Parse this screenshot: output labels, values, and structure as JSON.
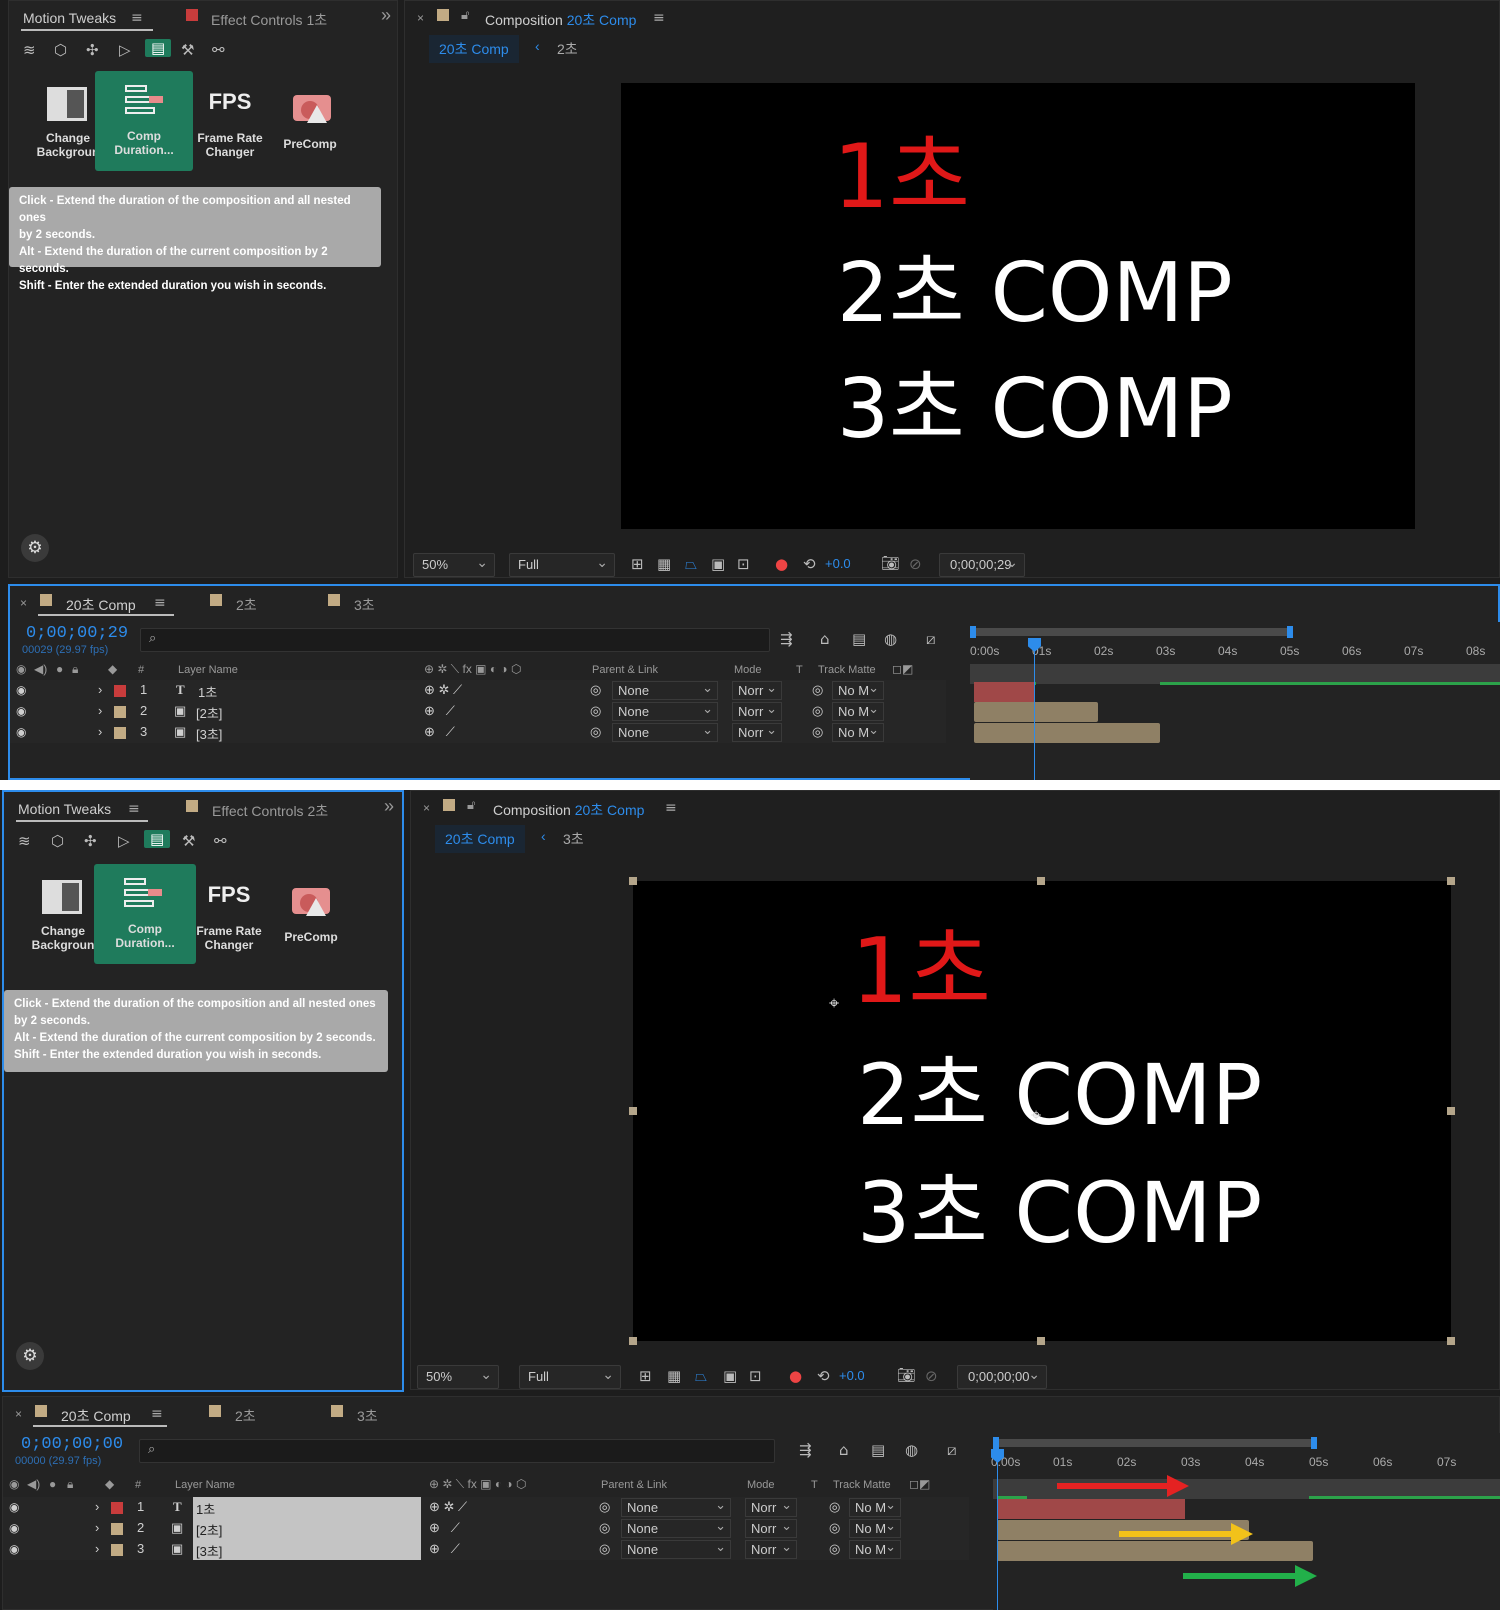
{
  "top": {
    "left_panel": {
      "tab_active": "Motion Tweaks",
      "tab_inactive": "Effect Controls 1초",
      "overflow": "»"
    },
    "comp_panel": {
      "tab_prefix": "Composition",
      "tab_comp": "20초 Comp",
      "breadcrumb_active": "20초 Comp",
      "breadcrumb_next": "2초"
    },
    "viewer_lines": [
      "1초",
      "2초 COMP",
      "3초 COMP"
    ],
    "zoom": "50%",
    "quality": "Full",
    "exposure": "+0.0",
    "timecode": "0;00;00;29",
    "timeline": {
      "tabs": [
        "20초 Comp",
        "2초",
        "3초"
      ],
      "time": "0;00;00;29",
      "frames": "00029 (29.97 fps)",
      "ruler": [
        "0:00s",
        "01s",
        "02s",
        "03s",
        "04s",
        "05s",
        "06s",
        "07s",
        "08s"
      ]
    }
  },
  "bottom": {
    "left_panel": {
      "tab_active": "Motion Tweaks",
      "tab_inactive": "Effect Controls 2초",
      "overflow": "»"
    },
    "comp_panel": {
      "tab_prefix": "Composition",
      "tab_comp": "20초 Comp",
      "breadcrumb_active": "20초 Comp",
      "breadcrumb_next": "3초"
    },
    "viewer_lines": [
      "1초",
      "2초 COMP",
      "3초 COMP"
    ],
    "zoom": "50%",
    "quality": "Full",
    "exposure": "+0.0",
    "timecode": "0;00;00;00",
    "timeline": {
      "tabs": [
        "20초 Comp",
        "2초",
        "3초"
      ],
      "time": "0;00;00;00",
      "frames": "00000 (29.97 fps)",
      "ruler": [
        "0:00s",
        "01s",
        "02s",
        "03s",
        "04s",
        "05s",
        "06s",
        "07s"
      ]
    }
  },
  "tools": [
    {
      "name": "change-background",
      "label_1": "Change",
      "label_2": "Backgroun"
    },
    {
      "name": "comp-duration",
      "label_1": "Comp",
      "label_2": "Duration..."
    },
    {
      "name": "frame-rate-changer",
      "icon_text": "FPS",
      "label_1": "Frame Rate",
      "label_2": "Changer"
    },
    {
      "name": "precomp",
      "label_1": "PreComp",
      "label_2": ""
    }
  ],
  "tooltip": {
    "line1": "Click - Extend the duration of the composition and all nested ones",
    "line2": "by 2 seconds.",
    "line3": "Alt - Extend the duration of the current composition by 2 seconds.",
    "line4": "Shift - Enter the extended duration you wish in seconds."
  },
  "columns": {
    "hash": "#",
    "layer_name": "Layer Name",
    "parent": "Parent & Link",
    "mode": "Mode",
    "t": "T",
    "track_matte": "Track Matte"
  },
  "layers": [
    {
      "num": "1",
      "type_icon": "T",
      "name": "1초",
      "color": "#c83c3c",
      "parent": "None",
      "mode": "Norr",
      "matte": "No M"
    },
    {
      "num": "2",
      "type_icon": "▣",
      "name": "[2초]",
      "color": "#c2ab84",
      "parent": "None",
      "mode": "Norr",
      "matte": "No M"
    },
    {
      "num": "3",
      "type_icon": "▣",
      "name": "[3초]",
      "color": "#c2ab84",
      "parent": "None",
      "mode": "Norr",
      "matte": "No M"
    }
  ],
  "colors": {
    "accent_blue": "#2d8ceb",
    "selected_tool": "#1f7b5c",
    "text_red": "#e01818",
    "layer_red": "#c83c3c",
    "layer_tan": "#c2ab84",
    "bar_red": "#a04848",
    "bar_tan": "#8f8065",
    "arrow_red": "#e52222",
    "arrow_yellow": "#f2c21a",
    "arrow_green": "#22b04a"
  }
}
